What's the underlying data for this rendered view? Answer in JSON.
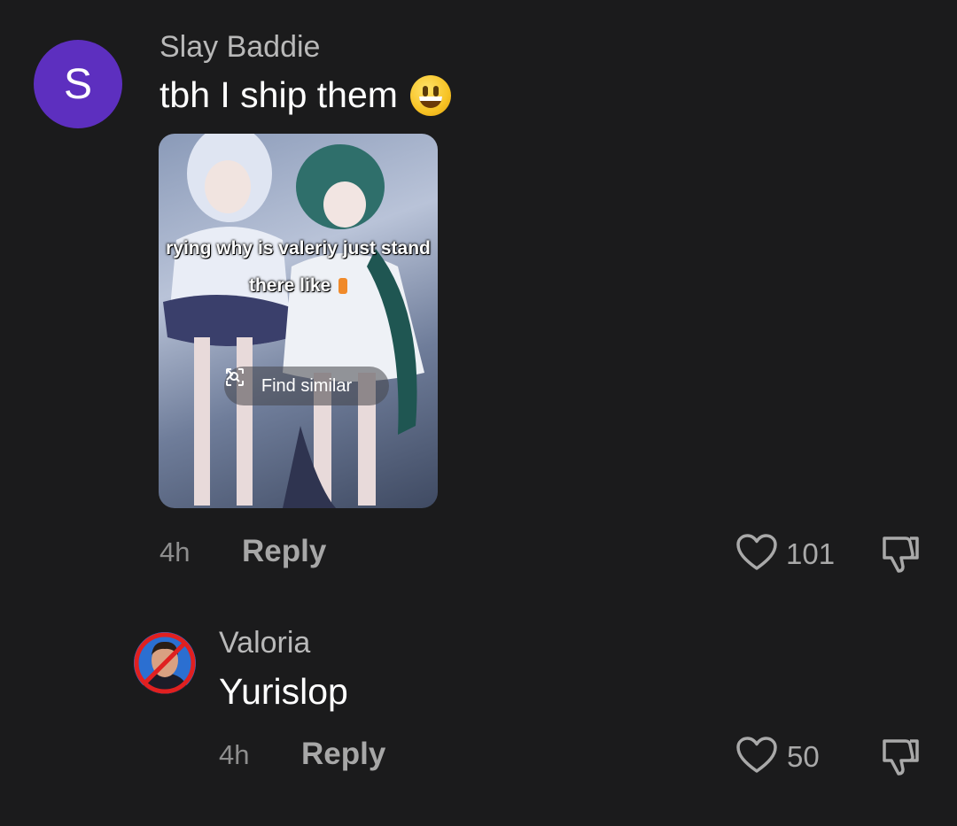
{
  "comments": [
    {
      "avatar_letter": "S",
      "username": "Slay Baddie",
      "text": "tbh I ship them",
      "emoji": "grinning-face-emoji",
      "media": {
        "caption_line1": "rying why is valeriy just stand",
        "caption_line2": "there like",
        "find_similar_label": "Find similar"
      },
      "time": "4h",
      "reply_label": "Reply",
      "likes": "101"
    },
    {
      "username": "Valoria",
      "text": "Yurislop",
      "time": "4h",
      "reply_label": "Reply",
      "likes": "50"
    }
  ],
  "icons": {
    "like": "heart-outline-icon",
    "dislike": "thumbs-down-outline-icon",
    "find_similar": "image-search-icon"
  },
  "colors": {
    "background": "#1b1b1c",
    "avatar_purple": "#5d2fbf",
    "muted_text": "#a7a7a7"
  }
}
